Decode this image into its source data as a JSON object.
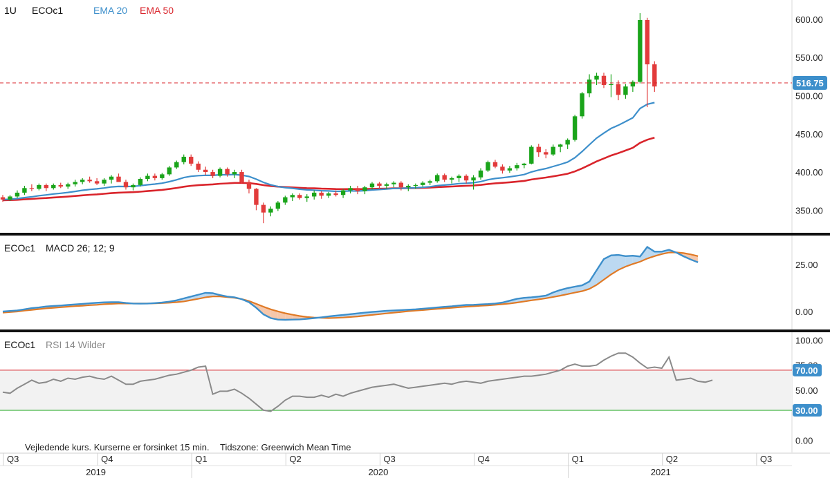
{
  "legend": {
    "interval": "1U",
    "symbol": "ECOc1",
    "ema20_label": "EMA 20",
    "ema50_label": "EMA 50"
  },
  "macd": {
    "symbol": "ECOc1",
    "label": "MACD 26; 12; 9"
  },
  "rsi": {
    "symbol": "ECOc1",
    "label": "RSI 14 Wilder"
  },
  "footer": {
    "disclaimer": "Vejledende kurs. Kurserne er forsinket 15 min.",
    "timezone": "Tidszone: Greenwich Mean Time"
  },
  "colors": {
    "up": "#1aa41a",
    "down": "#e23b3b",
    "ema20": "#3d8fcb",
    "ema50": "#d9242b",
    "macd": "#3d8fcb",
    "signal": "#e07a26",
    "rsi": "#8a8a8a",
    "badge": "#3d8fcb"
  },
  "chart_data": [
    {
      "type": "candlestick",
      "title": "ECOc1",
      "interval": "1U",
      "y_ticks": [
        "350.00",
        "400.00",
        "450.00",
        "500.00",
        "550.00",
        "600.00"
      ],
      "ylim": [
        325,
        618
      ],
      "last_price": "516.75",
      "last_price_value": 516.75,
      "x_quarters": [
        "Q3",
        "Q4",
        "Q1",
        "Q2",
        "Q3",
        "Q4",
        "Q1",
        "Q2",
        "Q3"
      ],
      "x_years": [
        "2019",
        "2020",
        "2021"
      ],
      "candles_start": 0,
      "candles_end": 89,
      "quarter_index": [
        0,
        13,
        26,
        39,
        52,
        65,
        78,
        91,
        104
      ],
      "ohlc": [
        [
          367,
          370,
          361,
          364
        ],
        [
          364,
          370,
          362,
          368
        ],
        [
          368,
          376,
          366,
          373
        ],
        [
          373,
          382,
          370,
          379
        ],
        [
          379,
          384,
          375,
          378
        ],
        [
          378,
          385,
          376,
          383
        ],
        [
          383,
          385,
          375,
          379
        ],
        [
          379,
          385,
          377,
          383
        ],
        [
          383,
          386,
          379,
          381
        ],
        [
          381,
          386,
          378,
          384
        ],
        [
          384,
          390,
          381,
          387
        ],
        [
          387,
          392,
          384,
          390
        ],
        [
          390,
          394,
          386,
          388
        ],
        [
          388,
          392,
          383,
          385
        ],
        [
          385,
          392,
          382,
          390
        ],
        [
          390,
          396,
          385,
          394
        ],
        [
          394,
          398,
          388,
          387
        ],
        [
          387,
          390,
          377,
          380
        ],
        [
          380,
          385,
          376,
          383
        ],
        [
          383,
          393,
          381,
          391
        ],
        [
          391,
          398,
          388,
          395
        ],
        [
          395,
          398,
          389,
          392
        ],
        [
          392,
          399,
          390,
          397
        ],
        [
          397,
          408,
          395,
          406
        ],
        [
          406,
          415,
          404,
          413
        ],
        [
          413,
          423,
          410,
          420
        ],
        [
          420,
          423,
          408,
          411
        ],
        [
          411,
          414,
          400,
          403
        ],
        [
          403,
          407,
          396,
          400
        ],
        [
          400,
          403,
          392,
          395
        ],
        [
          395,
          406,
          393,
          404
        ],
        [
          404,
          406,
          394,
          397
        ],
        [
          397,
          403,
          392,
          400
        ],
        [
          400,
          403,
          385,
          387
        ],
        [
          387,
          390,
          372,
          378
        ],
        [
          378,
          379,
          350,
          357
        ],
        [
          357,
          360,
          333,
          347
        ],
        [
          347,
          355,
          342,
          352
        ],
        [
          352,
          362,
          349,
          360
        ],
        [
          360,
          369,
          357,
          367
        ],
        [
          367,
          372,
          362,
          370
        ],
        [
          370,
          372,
          364,
          366
        ],
        [
          366,
          371,
          361,
          368
        ],
        [
          368,
          376,
          364,
          373
        ],
        [
          373,
          375,
          365,
          369
        ],
        [
          369,
          374,
          366,
          372
        ],
        [
          372,
          376,
          368,
          370
        ],
        [
          370,
          378,
          366,
          376
        ],
        [
          376,
          382,
          372,
          379
        ],
        [
          379,
          382,
          371,
          375
        ],
        [
          375,
          382,
          371,
          380
        ],
        [
          380,
          387,
          377,
          385
        ],
        [
          385,
          387,
          378,
          382
        ],
        [
          382,
          386,
          378,
          384
        ],
        [
          384,
          388,
          380,
          386
        ],
        [
          386,
          388,
          376,
          380
        ],
        [
          380,
          384,
          375,
          382
        ],
        [
          382,
          385,
          378,
          383
        ],
        [
          383,
          388,
          381,
          386
        ],
        [
          386,
          390,
          383,
          388
        ],
        [
          388,
          398,
          386,
          396
        ],
        [
          396,
          398,
          387,
          390
        ],
        [
          390,
          394,
          385,
          392
        ],
        [
          392,
          397,
          387,
          395
        ],
        [
          395,
          397,
          385,
          389
        ],
        [
          389,
          396,
          377,
          393
        ],
        [
          393,
          405,
          390,
          402
        ],
        [
          402,
          415,
          400,
          413
        ],
        [
          413,
          416,
          405,
          407
        ],
        [
          407,
          410,
          398,
          402
        ],
        [
          402,
          408,
          399,
          405
        ],
        [
          405,
          412,
          402,
          409
        ],
        [
          409,
          412,
          405,
          411
        ],
        [
          411,
          435,
          410,
          433
        ],
        [
          433,
          437,
          420,
          426
        ],
        [
          426,
          430,
          418,
          423
        ],
        [
          423,
          436,
          421,
          433
        ],
        [
          433,
          437,
          426,
          436
        ],
        [
          436,
          444,
          430,
          442
        ],
        [
          442,
          475,
          440,
          473
        ],
        [
          473,
          505,
          470,
          503
        ],
        [
          503,
          528,
          498,
          521
        ],
        [
          521,
          530,
          514,
          526
        ],
        [
          526,
          530,
          510,
          514
        ],
        [
          514,
          528,
          498,
          515
        ],
        [
          515,
          520,
          494,
          501
        ],
        [
          501,
          515,
          496,
          512
        ],
        [
          512,
          520,
          505,
          518
        ],
        [
          518,
          608,
          516,
          599
        ],
        [
          599,
          602,
          485,
          541
        ],
        [
          541,
          545,
          505,
          512
        ]
      ]
    },
    {
      "type": "line",
      "title": "MACD 26; 12; 9",
      "y_ticks": [
        "0.00",
        "25.00"
      ],
      "ylim": [
        -7,
        38
      ],
      "series": [
        {
          "name": "MACD",
          "values": [
            0,
            0.3,
            0.6,
            1.2,
            1.8,
            2.2,
            2.7,
            3.0,
            3.2,
            3.5,
            3.8,
            4.1,
            4.4,
            4.7,
            4.9,
            5.0,
            5.0,
            4.6,
            4.3,
            4.2,
            4.3,
            4.5,
            4.8,
            5.3,
            6.0,
            7.0,
            8.0,
            9.0,
            10.0,
            9.8,
            8.8,
            8.0,
            7.6,
            6.6,
            5.0,
            2.0,
            -1.5,
            -3.5,
            -4.3,
            -4.4,
            -4.3,
            -4.2,
            -3.9,
            -3.5,
            -3.1,
            -2.6,
            -2.2,
            -1.8,
            -1.4,
            -1.0,
            -0.6,
            -0.2,
            0.1,
            0.4,
            0.6,
            0.8,
            1.0,
            1.2,
            1.5,
            1.8,
            2.2,
            2.5,
            2.8,
            3.2,
            3.5,
            3.6,
            3.8,
            4.0,
            4.3,
            4.8,
            5.8,
            6.8,
            7.3,
            7.6,
            8.0,
            8.5,
            10.2,
            11.5,
            12.5,
            13.3,
            14.0,
            16.0,
            22.0,
            28.0,
            30.0,
            30.2,
            29.6,
            29.8,
            29.4,
            34.5,
            32.0,
            32.0,
            33.0,
            31.5,
            29.5,
            27.8,
            26.3
          ]
        },
        {
          "name": "Signal",
          "values": [
            -0.6,
            -0.3,
            0.0,
            0.5,
            0.9,
            1.3,
            1.7,
            2.0,
            2.3,
            2.6,
            2.9,
            3.1,
            3.4,
            3.6,
            3.9,
            4.1,
            4.3,
            4.3,
            4.3,
            4.3,
            4.3,
            4.4,
            4.5,
            4.7,
            5.0,
            5.4,
            6.1,
            6.8,
            7.6,
            8.1,
            8.1,
            7.7,
            7.3,
            6.7,
            5.6,
            4.1,
            2.6,
            1.2,
            0.1,
            -0.9,
            -1.7,
            -2.4,
            -2.9,
            -3.2,
            -3.4,
            -3.5,
            -3.4,
            -3.2,
            -2.9,
            -2.6,
            -2.2,
            -1.8,
            -1.4,
            -1.0,
            -0.6,
            -0.2,
            0.2,
            0.5,
            0.8,
            1.1,
            1.4,
            1.7,
            2.0,
            2.3,
            2.6,
            2.8,
            3.1,
            3.3,
            3.6,
            3.9,
            4.3,
            4.8,
            5.4,
            6.0,
            6.5,
            7.1,
            7.8,
            8.5,
            9.3,
            10.1,
            10.9,
            12.1,
            14.2,
            17.0,
            19.8,
            22.2,
            24.0,
            25.4,
            26.6,
            28.3,
            29.6,
            30.7,
            31.5,
            31.6,
            31.2,
            30.5,
            29.6
          ]
        }
      ]
    },
    {
      "type": "line",
      "title": "RSI 14 Wilder",
      "y_ticks": [
        "0.00",
        "50.00",
        "75.00",
        "100.00"
      ],
      "ylim": [
        -10,
        103
      ],
      "overbought": "70.00",
      "overbought_value": 70,
      "oversold": "30.00",
      "oversold_value": 30,
      "series": [
        {
          "name": "RSI",
          "values": [
            48,
            47,
            52,
            56,
            60,
            57,
            58,
            61,
            59,
            62,
            61,
            63,
            64,
            62,
            61,
            64,
            60,
            56,
            56,
            59,
            60,
            61,
            63,
            65,
            66,
            68,
            70,
            73,
            74,
            46,
            49,
            49,
            51,
            47,
            42,
            36,
            30,
            29,
            34,
            40,
            44,
            44,
            43,
            43,
            45,
            43,
            46,
            44,
            47,
            49,
            51,
            53,
            54,
            55,
            56,
            54,
            52,
            53,
            54,
            55,
            56,
            57,
            56,
            58,
            59,
            58,
            57,
            59,
            60,
            61,
            62,
            63,
            64,
            64,
            65,
            66,
            68,
            70,
            74,
            76,
            74,
            74,
            75,
            80,
            84,
            87,
            87,
            83,
            77,
            72,
            73,
            72,
            83,
            60,
            61,
            62,
            59,
            58,
            60
          ]
        }
      ]
    }
  ]
}
